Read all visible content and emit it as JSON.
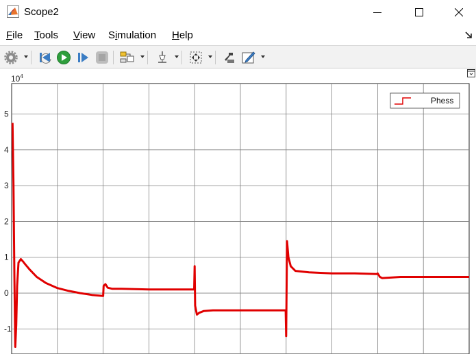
{
  "window": {
    "title": "Scope2"
  },
  "menu": {
    "items": [
      {
        "label": "File",
        "mnemonic": "F"
      },
      {
        "label": "Tools",
        "mnemonic": "T"
      },
      {
        "label": "View",
        "mnemonic": "V"
      },
      {
        "label": "Simulation",
        "mnemonic": "i"
      },
      {
        "label": "Help",
        "mnemonic": "H"
      }
    ]
  },
  "toolbar": {
    "icons": [
      "settings-icon",
      "step-back-icon",
      "run-icon",
      "step-forward-icon",
      "stop-icon",
      "signal-selector-icon",
      "cursor-measurements-icon",
      "zoom-autoscale-icon",
      "highlight-block-icon",
      "edit-icon"
    ]
  },
  "chart_data": {
    "type": "line",
    "y_exponent_label": "x10^4",
    "yticks": [
      "5",
      "4",
      "3",
      "2",
      "1",
      "0",
      "-1"
    ],
    "ylim": [
      -1.7,
      5.85
    ],
    "xlim": [
      0,
      10
    ],
    "grid": true,
    "legend_placement": "top-right",
    "series": [
      {
        "name": "Phess",
        "color": "#e00000",
        "x": [
          0.02,
          0.04,
          0.06,
          0.08,
          0.1,
          0.12,
          0.15,
          0.2,
          0.25,
          0.3,
          0.4,
          0.55,
          0.75,
          1.0,
          1.25,
          1.5,
          1.75,
          2.0,
          2.01,
          2.05,
          2.1,
          2.2,
          2.4,
          3.0,
          3.5,
          3.99,
          4.0,
          4.01,
          4.05,
          4.1,
          4.2,
          4.4,
          5.0,
          5.5,
          5.99,
          6.0,
          6.02,
          6.05,
          6.1,
          6.2,
          6.5,
          7.0,
          7.5,
          7.99,
          8.0,
          8.05,
          8.1,
          8.5,
          9.0,
          9.5,
          10.0
        ],
        "y": [
          4.75,
          3.0,
          0.5,
          -1.5,
          -0.9,
          0.2,
          0.85,
          0.95,
          0.88,
          0.8,
          0.65,
          0.45,
          0.28,
          0.14,
          0.06,
          0.0,
          -0.05,
          -0.08,
          0.2,
          0.25,
          0.15,
          0.12,
          0.12,
          0.1,
          0.1,
          0.1,
          0.75,
          -0.35,
          -0.6,
          -0.55,
          -0.5,
          -0.48,
          -0.48,
          -0.48,
          -0.48,
          -1.2,
          1.45,
          1.0,
          0.75,
          0.62,
          0.58,
          0.55,
          0.55,
          0.53,
          0.55,
          0.45,
          0.42,
          0.45,
          0.45,
          0.45,
          0.45
        ]
      }
    ]
  }
}
